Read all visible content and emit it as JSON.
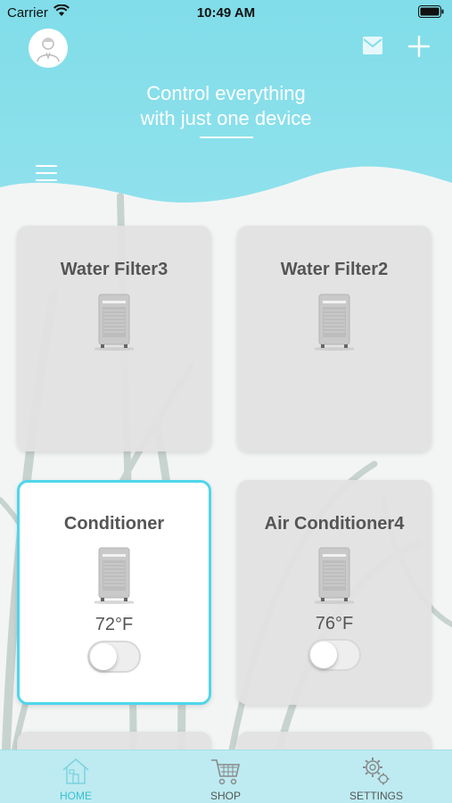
{
  "status_bar": {
    "carrier": "Carrier",
    "time": "10:49 AM"
  },
  "header": {
    "headline_line1": "Control everything",
    "headline_line2": "with just one device",
    "avatar_icon": "user-avatar-icon",
    "mail_icon": "mail-icon",
    "add_icon": "plus-icon",
    "menu_icon": "hamburger-menu-icon",
    "color": "#7fdbe8"
  },
  "devices": [
    {
      "name": "Water Filter3",
      "temp": null,
      "active": false
    },
    {
      "name": "Water Filter2",
      "temp": null,
      "active": false
    },
    {
      "name": "Conditioner",
      "temp": "72°F",
      "active": true,
      "toggle_on": false
    },
    {
      "name": "Air Conditioner4",
      "temp": "76°F",
      "active": false,
      "toggle_on": false
    }
  ],
  "tabs": [
    {
      "label": "HOME",
      "icon": "home-icon",
      "active": true
    },
    {
      "label": "SHOP",
      "icon": "cart-icon",
      "active": false
    },
    {
      "label": "SETTINGS",
      "icon": "gears-icon",
      "active": false
    }
  ],
  "colors": {
    "accent": "#4fd6ea",
    "tabbar": "#bdebf1"
  }
}
